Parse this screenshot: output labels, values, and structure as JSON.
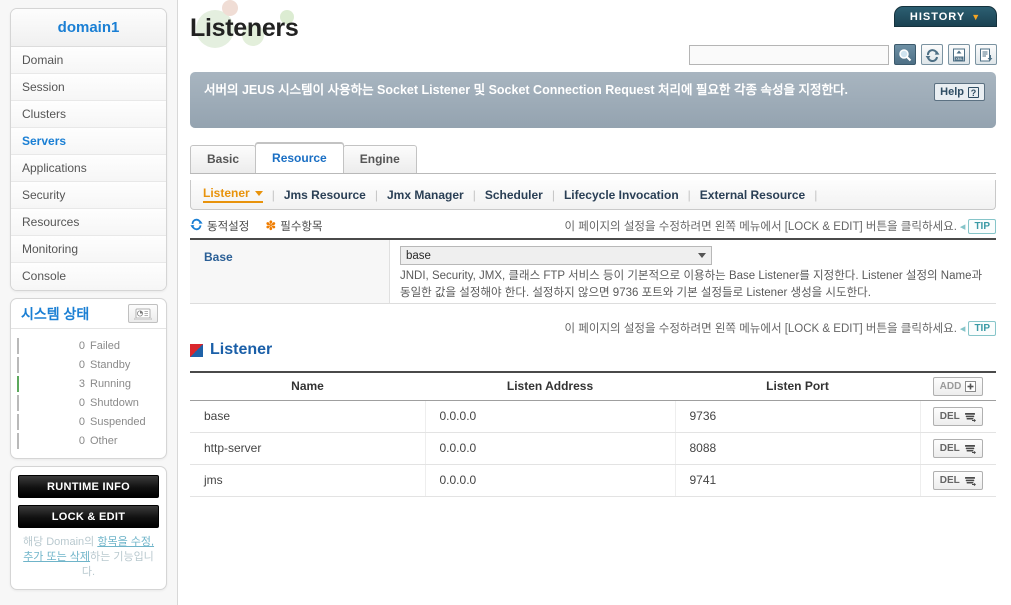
{
  "sidebar": {
    "domain_title": "domain1",
    "nav_items": [
      {
        "label": "Domain",
        "active": false
      },
      {
        "label": "Session",
        "active": false
      },
      {
        "label": "Clusters",
        "active": false
      },
      {
        "label": "Servers",
        "active": true
      },
      {
        "label": "Applications",
        "active": false
      },
      {
        "label": "Security",
        "active": false
      },
      {
        "label": "Resources",
        "active": false
      },
      {
        "label": "Monitoring",
        "active": false
      },
      {
        "label": "Console",
        "active": false
      }
    ],
    "status": {
      "title": "시스템 상태",
      "monitor_icon": "laptop-chart-icon",
      "rows": [
        {
          "count": "0",
          "label": "Failed",
          "filled": false
        },
        {
          "count": "0",
          "label": "Standby",
          "filled": false
        },
        {
          "count": "3",
          "label": "Running",
          "filled": true
        },
        {
          "count": "0",
          "label": "Shutdown",
          "filled": false
        },
        {
          "count": "0",
          "label": "Suspended",
          "filled": false
        },
        {
          "count": "0",
          "label": "Other",
          "filled": false
        }
      ]
    },
    "actions": {
      "runtime_info_label": "RUNTIME INFO",
      "lock_edit_label": "LOCK & EDIT",
      "description_pre": "해당 Domain의 ",
      "description_link": "항목을 수정, 추가 또는 삭제",
      "description_post": "하는 기능입니다."
    }
  },
  "header": {
    "page_title": "Listeners",
    "history_label": "HISTORY",
    "history_chevron_icon": "chevron-down-icon",
    "search_value": "",
    "search_placeholder": "",
    "tools": [
      {
        "name": "search-icon",
        "label": "search"
      },
      {
        "name": "refresh-icon",
        "label": "refresh"
      },
      {
        "name": "xml-export-icon",
        "label": "xml"
      },
      {
        "name": "download-export-icon",
        "label": "export"
      }
    ]
  },
  "banner": {
    "text": "서버의 JEUS 시스템이 사용하는 Socket Listener 및 Socket Connection Request 처리에 필요한 각종 속성을 지정한다.",
    "help_label": "Help",
    "help_icon": "question-mark-icon"
  },
  "tabs": [
    {
      "label": "Basic",
      "active": false
    },
    {
      "label": "Resource",
      "active": true
    },
    {
      "label": "Engine",
      "active": false
    }
  ],
  "subnav": [
    {
      "label": "Listener",
      "active": true,
      "has_caret": true
    },
    {
      "label": "Jms Resource",
      "active": false,
      "has_caret": false
    },
    {
      "label": "Jmx Manager",
      "active": false,
      "has_caret": false
    },
    {
      "label": "Scheduler",
      "active": false,
      "has_caret": false
    },
    {
      "label": "Lifecycle Invocation",
      "active": false,
      "has_caret": false
    },
    {
      "label": "External Resource",
      "active": false,
      "has_caret": false
    }
  ],
  "legend": {
    "dynamic_label": "동적설정",
    "dynamic_icon": "refresh-arrows-icon",
    "required_label": "필수항목",
    "required_icon": "asterisk-icon"
  },
  "tip": {
    "text": "이 페이지의 설정을 수정하려면 왼쪽 메뉴에서 [LOCK & EDIT] 버튼을 클릭하세요.",
    "chip_label": "TIP"
  },
  "base_section": {
    "label": "Base",
    "selected_value": "base",
    "caret_icon": "chevron-down-icon",
    "description": "JNDI, Security, JMX, 클래스 FTP 서비스 등이 기본적으로 이용하는 Base Listener를 지정한다. Listener 설정의 Name과 동일한 값을 설정해야 한다. 설정하지 않으면 9736 포트와 기본 설정들로 Listener 생성을 시도한다."
  },
  "listener_section": {
    "title": "Listener",
    "icon": "red-blue-square-icon",
    "add_label": "ADD",
    "add_icon": "plus-icon",
    "delete_label": "DEL",
    "delete_icon": "trash-icon",
    "columns": [
      "Name",
      "Listen Address",
      "Listen Port",
      ""
    ],
    "rows": [
      {
        "name": "base",
        "address": "0.0.0.0",
        "port": "9736"
      },
      {
        "name": "http-server",
        "address": "0.0.0.0",
        "port": "8088"
      },
      {
        "name": "jms",
        "address": "0.0.0.0",
        "port": "9741"
      }
    ]
  },
  "colors": {
    "accent_blue": "#1a7fd4",
    "active_orange": "#e8930c",
    "banner_gray": "#a8b5c0",
    "running_green": "#7cc47c",
    "history_teal": "#2c5f72"
  }
}
